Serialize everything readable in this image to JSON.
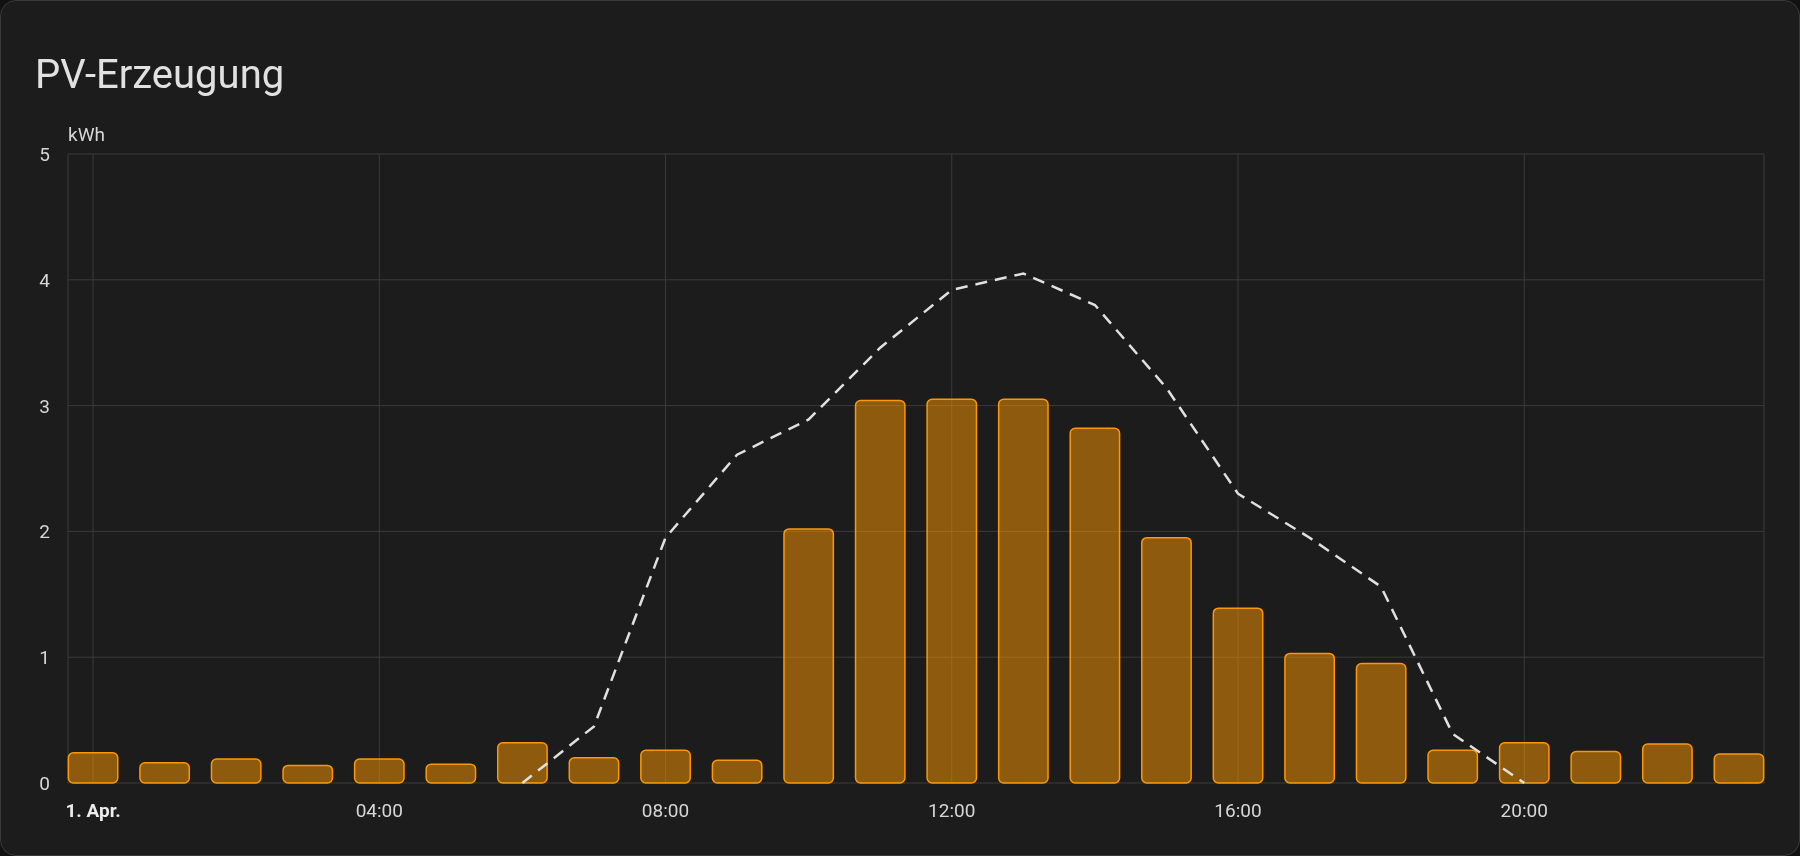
{
  "card": {
    "title": "PV-Erzeugung",
    "chart_data": {
      "type": "bar",
      "ylabel": "kWh",
      "grid": true,
      "ylim": [
        0,
        5
      ],
      "yticks": [
        0,
        1,
        2,
        3,
        4,
        5
      ],
      "xlim": [
        -0.35,
        23.35
      ],
      "xticks": [
        {
          "value": 0,
          "label": "1. Apr."
        },
        {
          "value": 4,
          "label": "04:00"
        },
        {
          "value": 8,
          "label": "08:00"
        },
        {
          "value": 12,
          "label": "12:00"
        },
        {
          "value": 16,
          "label": "16:00"
        },
        {
          "value": 20,
          "label": "20:00"
        }
      ],
      "x": [
        0,
        1,
        2,
        3,
        4,
        5,
        6,
        7,
        8,
        9,
        10,
        11,
        12,
        13,
        14,
        15,
        16,
        17,
        18,
        19,
        20,
        21,
        22,
        23
      ],
      "series": [
        {
          "color": "#ff9800",
          "values": [
            0.24,
            0.16,
            0.19,
            0.14,
            0.19,
            0.15,
            0.32,
            0.2,
            0.26,
            0.18,
            2.02,
            3.04,
            3.05,
            3.05,
            2.82,
            1.95,
            1.39,
            1.03,
            0.95,
            0.26,
            0.32,
            0.25,
            0.31,
            0.23
          ]
        },
        {
          "type": "line",
          "line_style": "dashed",
          "color": "#e0e0e0",
          "values": [
            null,
            null,
            null,
            null,
            null,
            null,
            0,
            0.45,
            1.95,
            2.61,
            2.89,
            3.46,
            3.92,
            4.05,
            3.8,
            3.14,
            2.3,
            1.95,
            1.56,
            0.39,
            0,
            null,
            null,
            null
          ]
        }
      ]
    }
  }
}
